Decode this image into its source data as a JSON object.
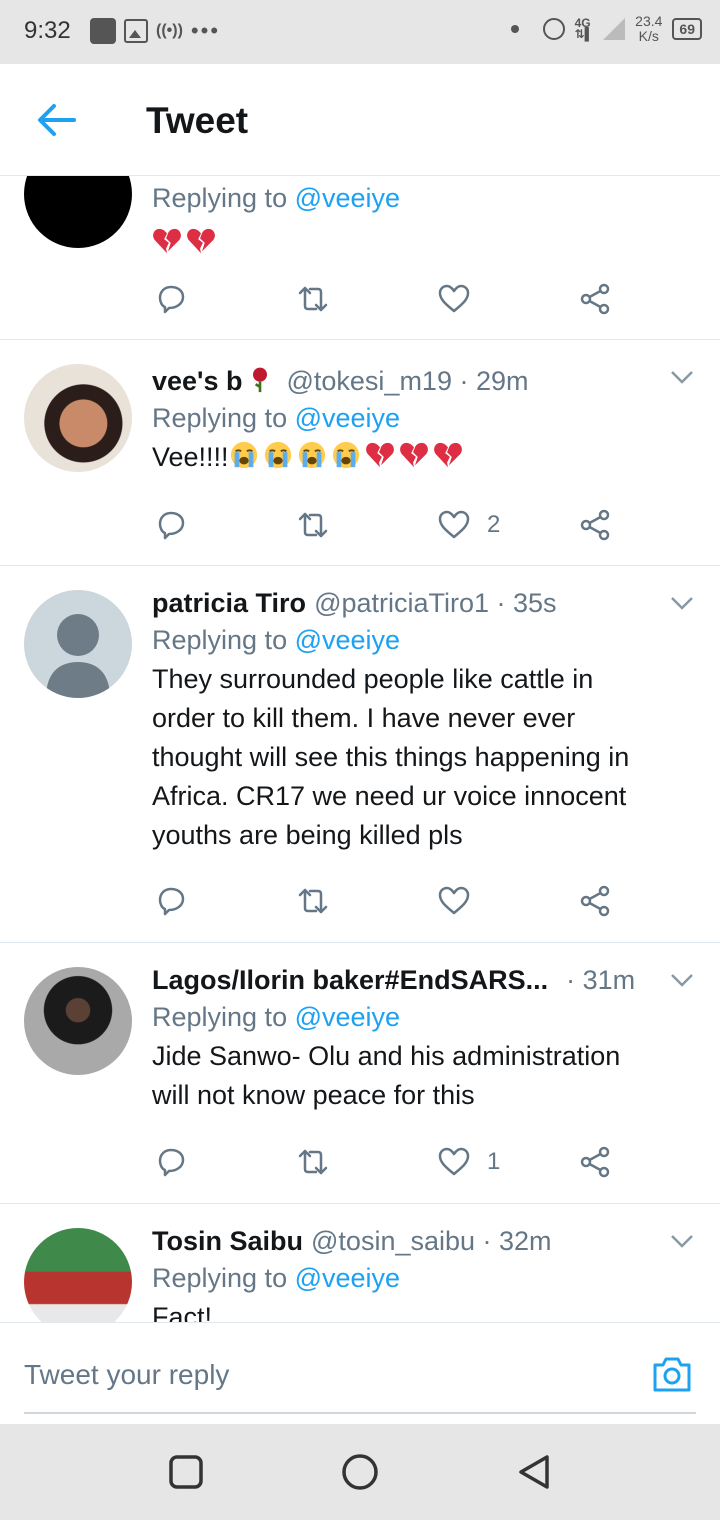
{
  "status": {
    "time": "9:32",
    "net": "4G",
    "speed_value": "23.4",
    "speed_unit": "K/s",
    "battery": "69"
  },
  "header": {
    "title": "Tweet"
  },
  "tweets": [
    {
      "name": "",
      "handle": "",
      "time": "",
      "replying_prefix": "Replying to ",
      "replying_to": "@veeiye",
      "text_emoji": [
        "broken-heart",
        "broken-heart"
      ],
      "text": "",
      "likes": "",
      "avatar": "black-circle"
    },
    {
      "name": "vee's b",
      "name_emoji": "rose",
      "handle": "@tokesi_m19 · 29m",
      "replying_prefix": "Replying to ",
      "replying_to": "@veeiye",
      "text": "Vee!!!!",
      "text_emoji": [
        "loudly-crying",
        "loudly-crying",
        "loudly-crying",
        "loudly-crying",
        "broken-heart",
        "broken-heart",
        "broken-heart"
      ],
      "likes": "2",
      "avatar": "profile-photo"
    },
    {
      "name": "patricia Tiro",
      "handle": "@patriciaTiro1 · 35s",
      "replying_prefix": "Replying to ",
      "replying_to": "@veeiye",
      "text_lines": [
        "They surrounded people like cattle in",
        "order to kill them. I have never ever",
        "thought will see this things happening in",
        "Africa. CR17 we need ur voice innocent",
        "youths are being killed pls"
      ],
      "likes": "",
      "avatar": "default-avatar"
    },
    {
      "name": "Lagos/Ilorin baker#EndSARS...",
      "handle": "· 31m",
      "replying_prefix": "Replying to ",
      "replying_to": "@veeiye",
      "text_lines": [
        "Jide Sanwo- Olu and his administration",
        "will not know peace for this"
      ],
      "likes": "1",
      "avatar": "profile-photo"
    },
    {
      "name": "Tosin Saibu",
      "handle": "@tosin_saibu · 32m",
      "replying_prefix": "Replying to ",
      "replying_to": "@veeiye",
      "text": "Fact!",
      "likes": "",
      "avatar": "flag-photo"
    }
  ],
  "reply_bar": {
    "placeholder": "Tweet your reply"
  },
  "icons": {
    "reply": "reply-icon",
    "retweet": "retweet-icon",
    "like": "like-icon",
    "share": "share-icon",
    "camera": "camera-icon"
  },
  "colors": {
    "accent": "#1da1f2",
    "muted": "#657786",
    "text": "#14171a",
    "divider": "#e1e8ed"
  }
}
